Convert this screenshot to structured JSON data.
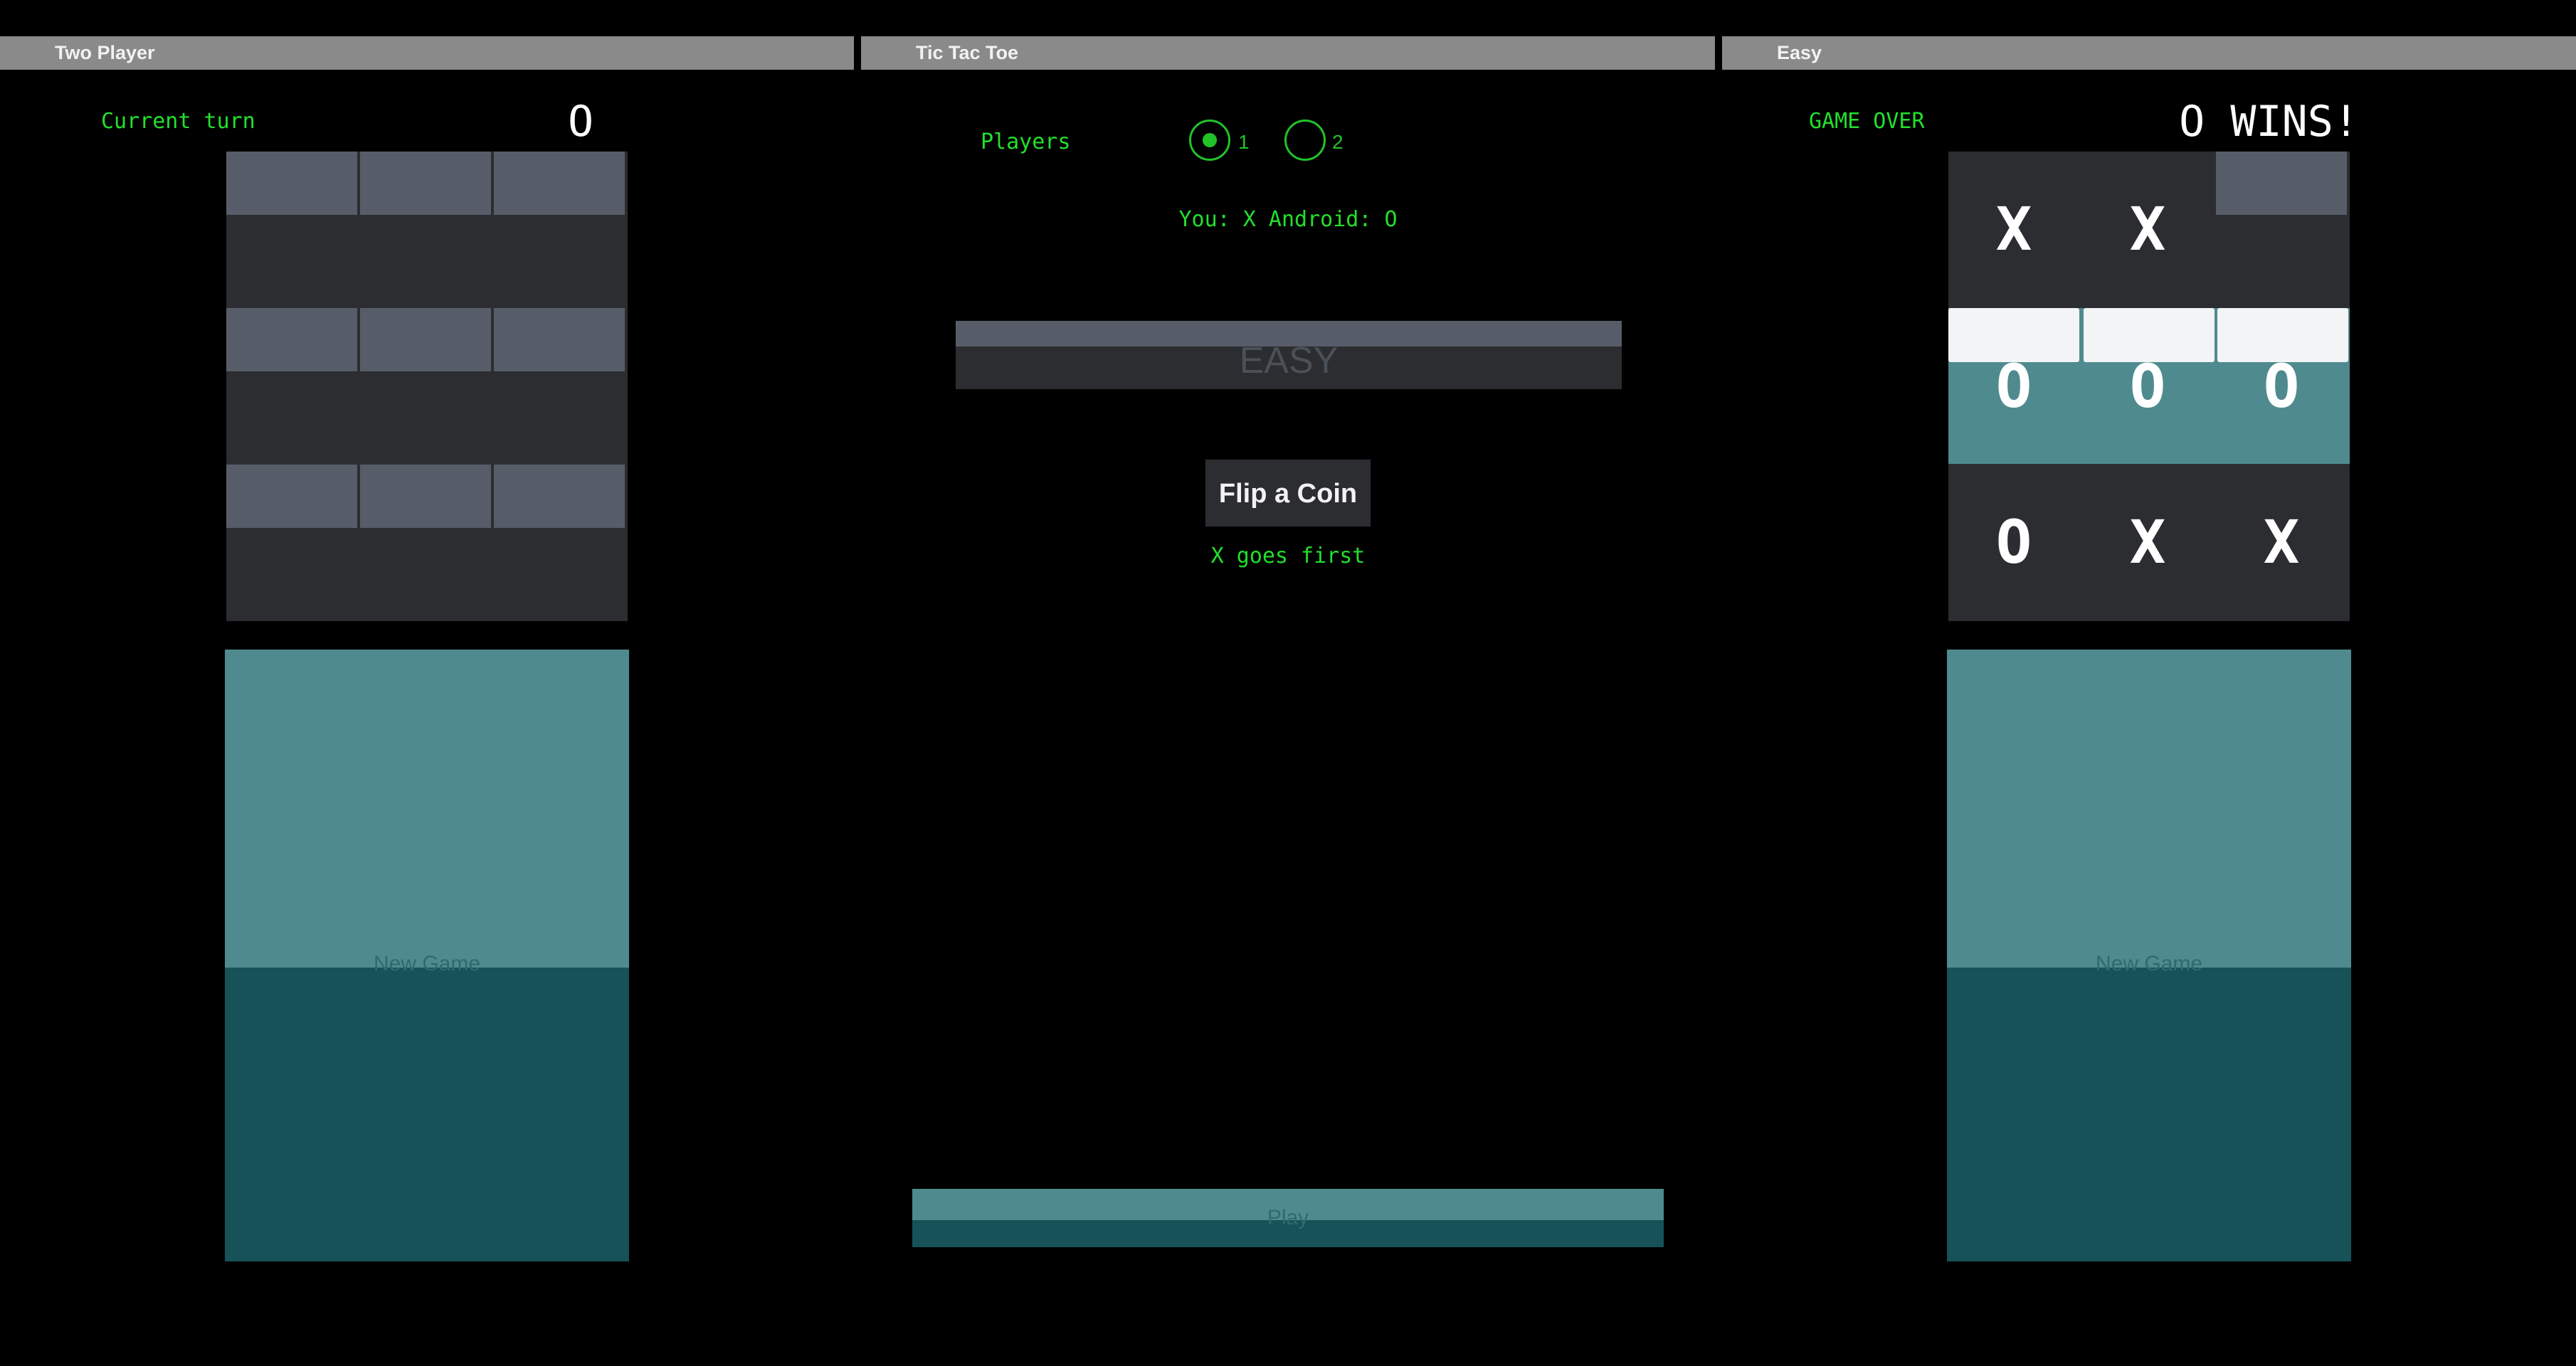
{
  "left_panel": {
    "title": "Two Player",
    "turn_label": "Current turn",
    "turn_value": "O",
    "board": [
      "",
      "",
      "",
      "",
      "",
      "",
      "",
      "",
      ""
    ],
    "new_game_label": "New Game"
  },
  "center_panel": {
    "title": "Tic Tac Toe",
    "players_label": "Players",
    "player_options": [
      "1",
      "2"
    ],
    "selected_players": "1",
    "assignment_text": "You: X Android: O",
    "difficulty_label": "EASY",
    "flip_button_label": "Flip a Coin",
    "flip_result": "X goes first",
    "play_label": "Play"
  },
  "right_panel": {
    "title": "Easy",
    "status_label": "GAME OVER",
    "result_text": "O WINS!",
    "board": [
      "X",
      "X",
      "",
      "O",
      "O",
      "O",
      "O",
      "X",
      "X"
    ],
    "winning_row": 1,
    "new_game_label": "New Game"
  },
  "colors": {
    "accent_green": "#22e02c",
    "title_bar": "#8a8a8a",
    "board_bg": "#2c2d30",
    "cell_top": "#575d68",
    "teal_light": "#4f8a8f",
    "teal_dark": "#175258"
  }
}
